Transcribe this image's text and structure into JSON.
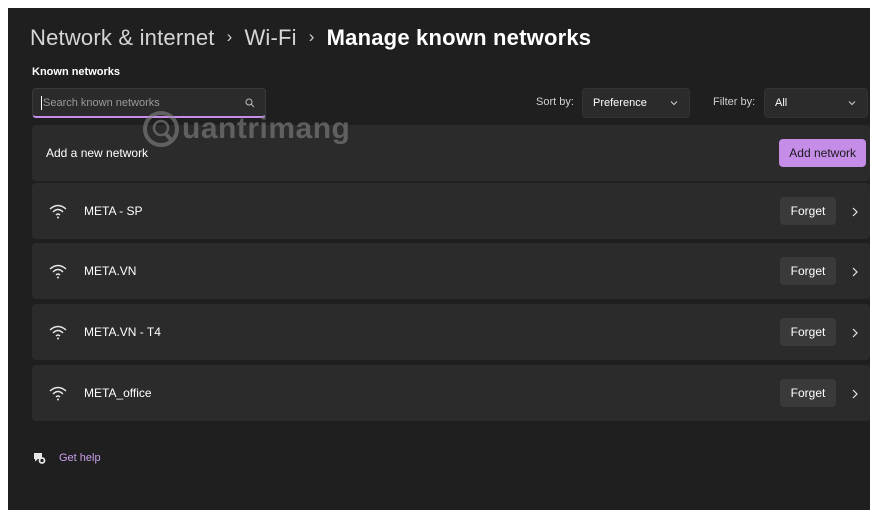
{
  "breadcrumb": {
    "items": [
      "Network & internet",
      "Wi-Fi"
    ],
    "current": "Manage known networks",
    "separator": "›"
  },
  "known_networks": {
    "section_label": "Known networks",
    "search_placeholder": "Search known networks",
    "sort_label": "Sort by:",
    "sort_value": "Preference",
    "filter_label": "Filter by:",
    "filter_value": "All"
  },
  "add_network": {
    "label": "Add a new network",
    "button": "Add network"
  },
  "networks": [
    {
      "name": "META - SP",
      "action": "Forget"
    },
    {
      "name": "META.VN",
      "action": "Forget"
    },
    {
      "name": "META.VN - T4",
      "action": "Forget"
    },
    {
      "name": "META_office",
      "action": "Forget"
    }
  ],
  "help": {
    "label": "Get help"
  },
  "watermark": {
    "text": "uantrimang"
  },
  "colors": {
    "accent": "#c58ce8",
    "background": "#1f1f1f",
    "card": "#2b2b2b"
  },
  "icons": {
    "wifi": "wifi-icon",
    "search": "search-icon",
    "chevron": "chevron-right-icon",
    "help": "help-icon"
  }
}
